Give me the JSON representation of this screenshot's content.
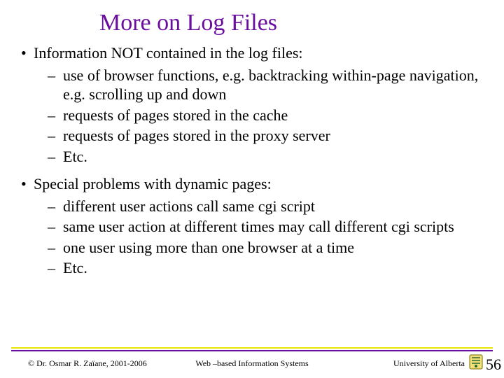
{
  "title": "More on Log Files",
  "bullets": [
    {
      "text": "Information NOT contained in the log files:",
      "sub": [
        "use of  browser functions, e.g. backtracking within-page navigation, e.g. scrolling up and down",
        "requests of pages stored in the cache",
        "requests of pages stored in the proxy server",
        "Etc."
      ]
    },
    {
      "text": "Special problems with dynamic pages:",
      "sub": [
        "different user actions call same cgi script",
        "same user action at different times may call different cgi scripts",
        "one user using more than one browser at a time",
        "Etc."
      ]
    }
  ],
  "footer": {
    "left": "© Dr. Osmar R. Zaïane, 2001-2006",
    "center": "Web –based Information Systems",
    "right": "University  of Alberta",
    "page": "56"
  }
}
